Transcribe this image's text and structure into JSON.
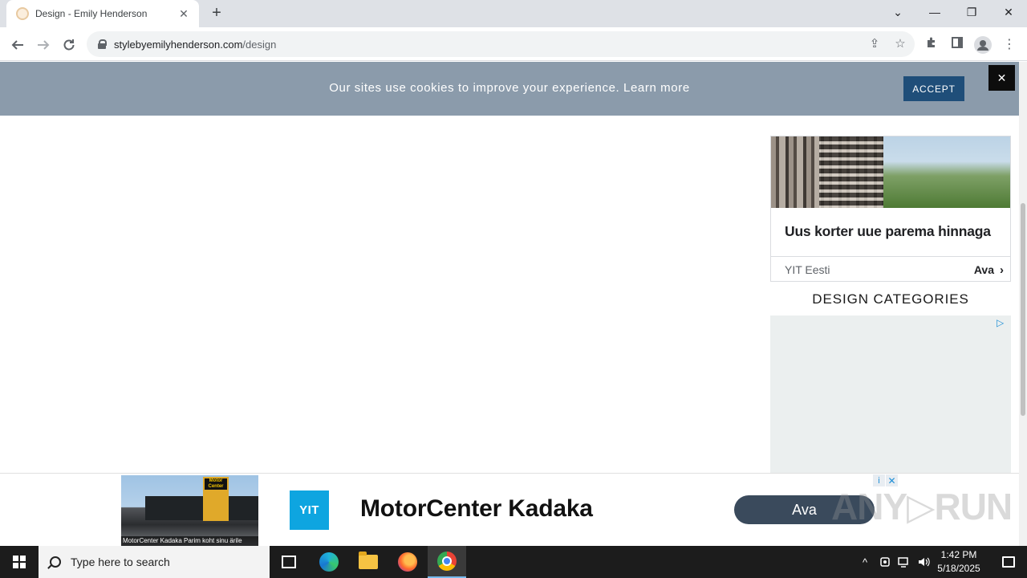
{
  "browser": {
    "tab_title": "Design - Emily Henderson",
    "tab_close": "✕",
    "new_tab": "+",
    "url_host": "stylebyemilyhenderson.com",
    "url_path": "/design",
    "window_controls": {
      "dropdown": "⌄",
      "minimize": "—",
      "restore": "❐",
      "close": "✕"
    }
  },
  "cookie_banner": {
    "message": "Our sites use cookies to improve your experience. Learn more",
    "accept_label": "ACCEPT",
    "close_label": "✕",
    "background_color": "#8b9bab",
    "accept_color": "#1f4e79"
  },
  "sidebar_ad": {
    "headline": "Uus korter uue parema hinnaga",
    "advertiser": "YIT Eesti",
    "cta": "Ava",
    "cta_chevron": "›"
  },
  "sidebar": {
    "section_title": "DESIGN CATEGORIES",
    "adchoices_icon": "▷"
  },
  "anchor_ad": {
    "image_caption": "MotorCenter Kadaka Parim koht sinu ärile",
    "image_logo": "Motor Center",
    "brand_logo": "YIT",
    "title": "MotorCenter Kadaka",
    "cta": "Ava",
    "info_icon": "i",
    "close_icon": "✕",
    "brand_color": "#0ea5e0",
    "cta_color": "#3a4a5c"
  },
  "watermark": "ANY▷RUN",
  "taskbar": {
    "search_placeholder": "Type here to search",
    "time": "1:42 PM",
    "date": "5/18/2025",
    "tray_chevron": "^"
  }
}
